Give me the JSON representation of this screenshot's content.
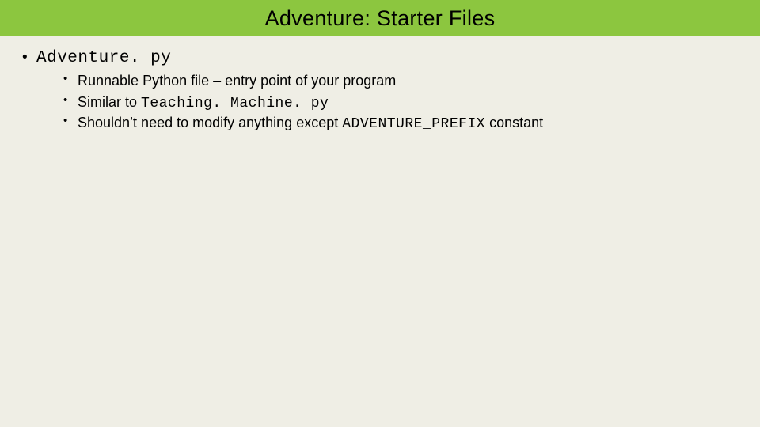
{
  "title": "Adventure: Starter Files",
  "outer_item": {
    "label_code": "Adventure. py"
  },
  "inner_items": [
    {
      "prefix": "Runnable Python file – entry point of your program",
      "code": "",
      "suffix": ""
    },
    {
      "prefix": "Similar to ",
      "code": "Teaching. Machine. py",
      "suffix": ""
    },
    {
      "prefix": "Shouldn’t need to modify anything except ",
      "code": "ADVENTURE_PREFIX",
      "suffix": " constant"
    }
  ]
}
